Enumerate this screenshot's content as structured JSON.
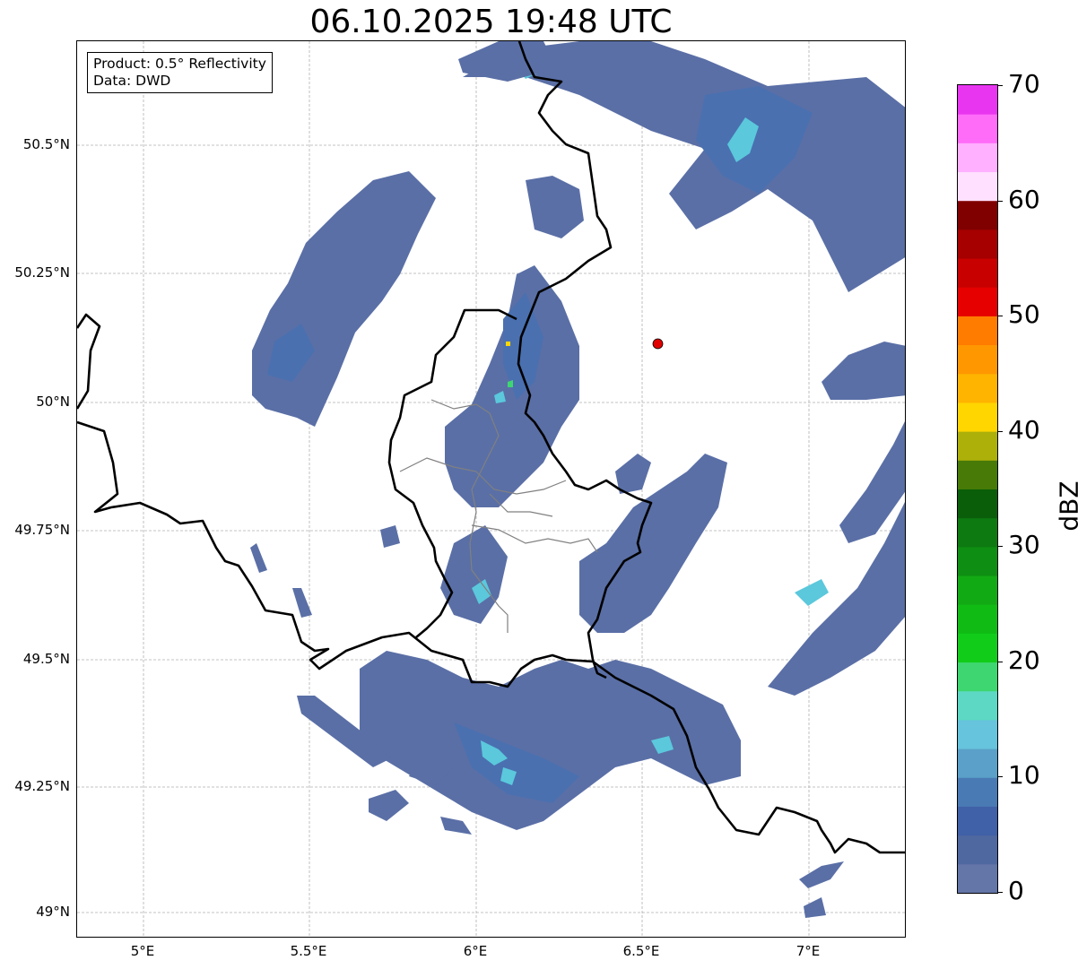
{
  "title": "06.10.2025 19:48 UTC",
  "info": {
    "product": "Product: 0.5° Reflectivity",
    "source": "Data: DWD"
  },
  "lat_labels": [
    "50.5°N",
    "50.25°N",
    "50°N",
    "49.75°N",
    "49.5°N",
    "49.25°N",
    "49°N"
  ],
  "lon_labels": [
    "5°E",
    "5.5°E",
    "6°E",
    "6.5°E",
    "7°E"
  ],
  "colorbar": {
    "unit": "dBZ",
    "min": 0,
    "max": 70,
    "tick_labels": [
      "0",
      "10",
      "20",
      "30",
      "40",
      "50",
      "60",
      "70"
    ],
    "colors": [
      "#6476a8",
      "#5068a0",
      "#4060a8",
      "#4a7ab4",
      "#5aa0c8",
      "#66c4dc",
      "#5cd8c4",
      "#3ed670",
      "#12cc1a",
      "#10bc14",
      "#12aa14",
      "#0e8e12",
      "#0c7a10",
      "#0a5e0a",
      "#487a08",
      "#acb008",
      "#ffd600",
      "#ffb400",
      "#ff9800",
      "#ff7c00",
      "#e60000",
      "#c80000",
      "#a60000",
      "#800000",
      "#ffe0ff",
      "#ffb0ff",
      "#ff6cf8",
      "#e836f0"
    ]
  },
  "map": {
    "lon_range": [
      4.8,
      7.3
    ],
    "lat_range": [
      48.95,
      50.7
    ],
    "radar_site": {
      "lon": 6.55,
      "lat": 50.11,
      "color": "#e00000"
    },
    "echo_colors": {
      "weak": "#5a6fa6",
      "mid": "#4a70b0",
      "light": "#5bc8dc",
      "green": "#3ed670",
      "yellow": "#ffd600"
    }
  }
}
